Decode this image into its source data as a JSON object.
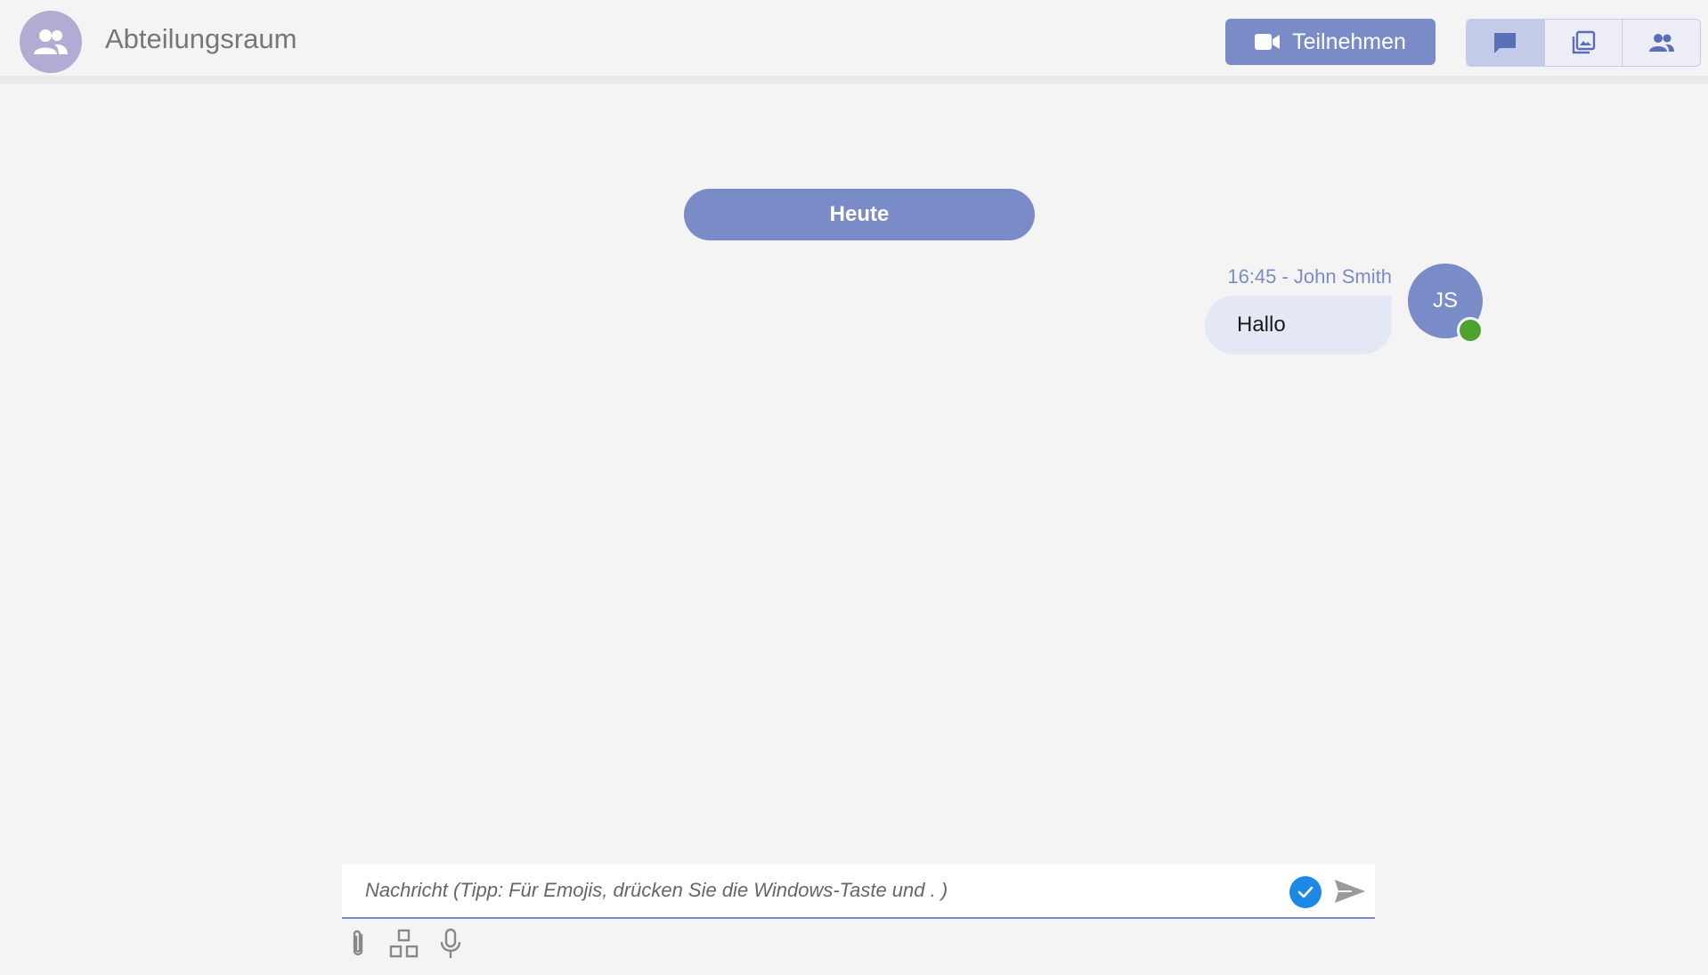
{
  "header": {
    "room_title": "Abteilungsraum",
    "room_icon": "group-icon",
    "join_label": "Teilnehmen",
    "join_icon": "video-camera-icon",
    "views": [
      {
        "name": "chat",
        "icon": "chat-bubble-icon",
        "active": true
      },
      {
        "name": "gallery",
        "icon": "image-gallery-icon",
        "active": false
      },
      {
        "name": "participants",
        "icon": "people-icon",
        "active": false
      }
    ]
  },
  "chat": {
    "day_separator": "Heute",
    "messages": [
      {
        "meta": "16:45 - John Smith",
        "text": "Hallo",
        "initials": "JS",
        "status": "online"
      }
    ]
  },
  "composer": {
    "placeholder": "Nachricht (Tipp: Für Emojis, drücken Sie die Windows-Taste und . )",
    "value": "",
    "tools": [
      "paperclip-icon",
      "apps-icon",
      "microphone-icon"
    ]
  },
  "colors": {
    "accent": "#7a8cc7",
    "room_avatar": "#b2abd3",
    "bubble": "#e4e7f4",
    "presence_online": "#4da32e",
    "check": "#1e88e5"
  }
}
